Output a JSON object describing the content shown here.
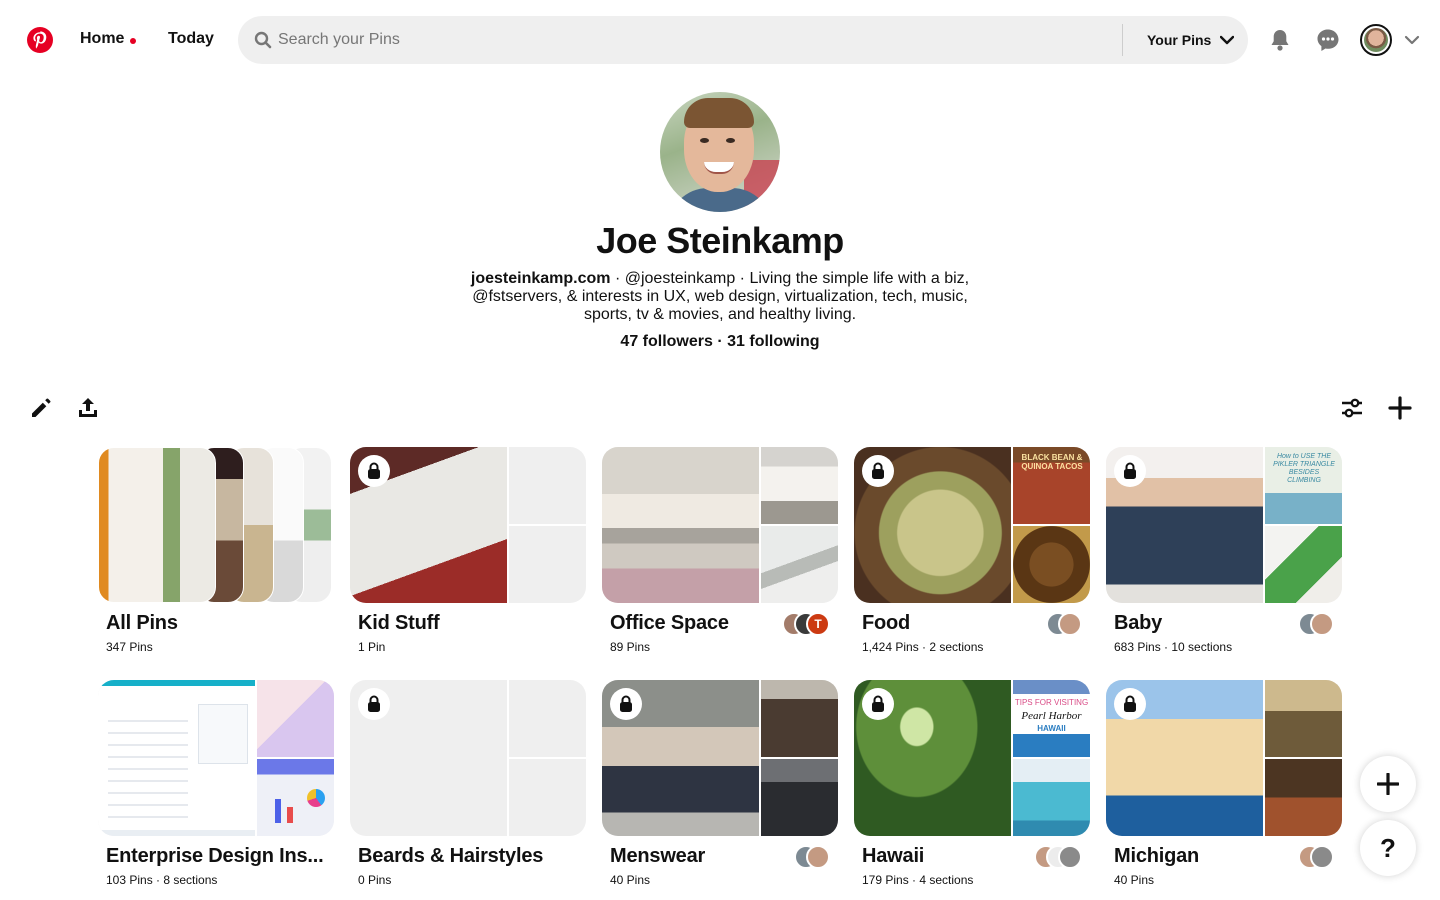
{
  "header": {
    "home_label": "Home",
    "today_label": "Today",
    "search_placeholder": "Search your Pins",
    "scope_label": "Your Pins"
  },
  "profile": {
    "name": "Joe Steinkamp",
    "website": "joesteinkamp.com",
    "bio": " · @joesteinkamp · Living the simple life with a biz, @fstservers, & interests in UX, web design, virtualization, tech, music, sports, tv & movies, and healthy living.",
    "followers": "47 followers",
    "following": "31 following",
    "follow_sep": " · "
  },
  "boards": [
    {
      "title": "All Pins",
      "meta": "347 Pins",
      "locked": false
    },
    {
      "title": "Kid Stuff",
      "meta": "1 Pin",
      "locked": true
    },
    {
      "title": "Office Space",
      "meta": "89 Pins",
      "locked": false
    },
    {
      "title": "Food",
      "meta": "1,424 Pins · 2 sections",
      "locked": true
    },
    {
      "title": "Baby",
      "meta": "683 Pins · 10 sections",
      "locked": true
    },
    {
      "title": "Enterprise Design Ins...",
      "meta": "103 Pins · 8 sections",
      "locked": false
    },
    {
      "title": "Beards & Hairstyles",
      "meta": "0 Pins",
      "locked": true
    },
    {
      "title": "Menswear",
      "meta": "40 Pins",
      "locked": true
    },
    {
      "title": "Hawaii",
      "meta": "179 Pins · 4 sections",
      "locked": true
    },
    {
      "title": "Michigan",
      "meta": "40 Pins",
      "locked": true
    }
  ],
  "cover_text": {
    "food_tile": "BLACK BEAN & QUINOA TACOS",
    "hawaii_tile_1": "TIPS FOR VISITING",
    "hawaii_tile_2": "Pearl Harbor",
    "hawaii_tile_3": "HAWAII",
    "baby_tile": "How to USE THE PIKLER TRIANGLE BESIDES CLIMBING"
  },
  "collaborator_initials": {
    "office_space": "T"
  },
  "fab": {
    "help_label": "?"
  },
  "colors": {
    "brand": "#e60023",
    "search_bg": "#efefef",
    "text": "#111111"
  }
}
